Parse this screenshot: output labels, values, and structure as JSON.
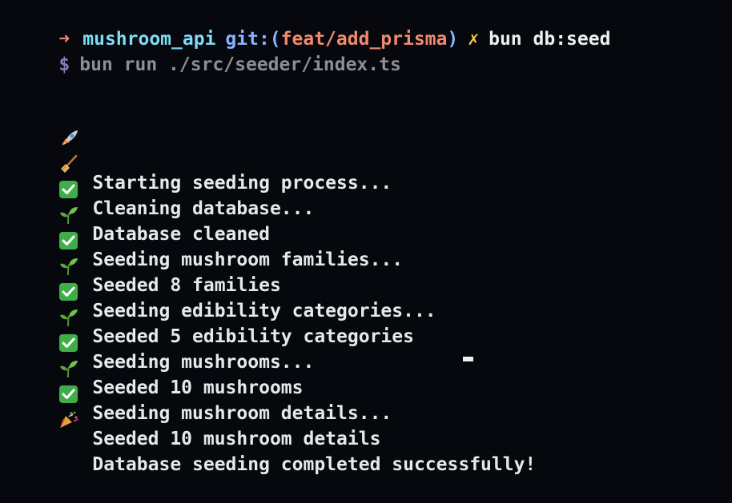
{
  "prompt": {
    "arrow": "➜",
    "directory": "mushroom_api",
    "git_prefix": "git:(",
    "branch": "feat/add_prisma",
    "git_suffix": ")",
    "dirty_mark": "✗",
    "command": "bun db:seed"
  },
  "subcommand": {
    "symbol": "$",
    "text": "bun run ./src/seeder/index.ts"
  },
  "output_lines": [
    {
      "icon": "rocket-icon",
      "text": "Starting seeding process..."
    },
    {
      "icon": "broom-icon",
      "text": "Cleaning database..."
    },
    {
      "icon": "check-icon",
      "text": "Database cleaned"
    },
    {
      "icon": "seedling-icon",
      "text": "Seeding mushroom families..."
    },
    {
      "icon": "check-icon",
      "text": "Seeded 8 families"
    },
    {
      "icon": "seedling-icon",
      "text": "Seeding edibility categories..."
    },
    {
      "icon": "check-icon",
      "text": "Seeded 5 edibility categories"
    },
    {
      "icon": "seedling-icon",
      "text": "Seeding mushrooms..."
    },
    {
      "icon": "check-icon",
      "text": "Seeded 10 mushrooms"
    },
    {
      "icon": "seedling-icon",
      "text": "Seeding mushroom details..."
    },
    {
      "icon": "check-icon",
      "text": "Seeded 10 mushroom details"
    },
    {
      "icon": "party-popper-icon",
      "text": "Database seeding completed successfully!"
    }
  ],
  "colors": {
    "background": "#06080e",
    "text": "#e6e8ec",
    "arrow": "#f08a6e",
    "directory": "#7fdcf5",
    "git": "#87b4ff",
    "dirty": "#f6c64a",
    "check_green": "#3fae49"
  }
}
